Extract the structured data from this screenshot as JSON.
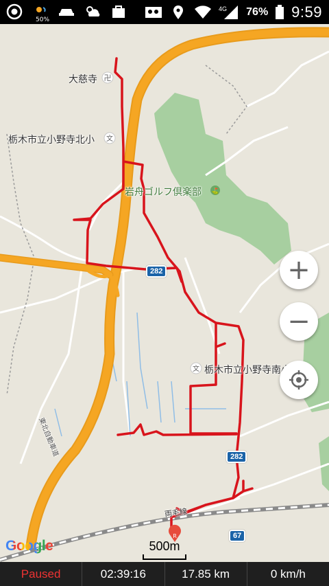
{
  "status_bar": {
    "weather_percent": "50%",
    "battery": "76%",
    "network": "4G",
    "time": "9:59"
  },
  "map": {
    "labels": {
      "temple": "大慈寺",
      "school_north": "栃木市立小野寺北小",
      "golf": "岩舟ゴルフ倶楽部",
      "school_south": "栃木市立小野寺南小",
      "expressway": "東北自動車道",
      "railway": "両毛線"
    },
    "route_shields": {
      "r282_top": "282",
      "r282_bottom": "282",
      "r67": "67"
    },
    "controls": {
      "zoom_in": "+",
      "zoom_out": "−"
    },
    "google_logo": "Google",
    "scale_label": "500m"
  },
  "tracker": {
    "status": "Paused",
    "elapsed": "02:39:16",
    "distance": "17.85 km",
    "speed": "0 km/h"
  },
  "colors": {
    "track": "#d8141c",
    "expressway": "#f5a623",
    "park": "#a7cfa0",
    "map_background": "#e9e6dc"
  }
}
